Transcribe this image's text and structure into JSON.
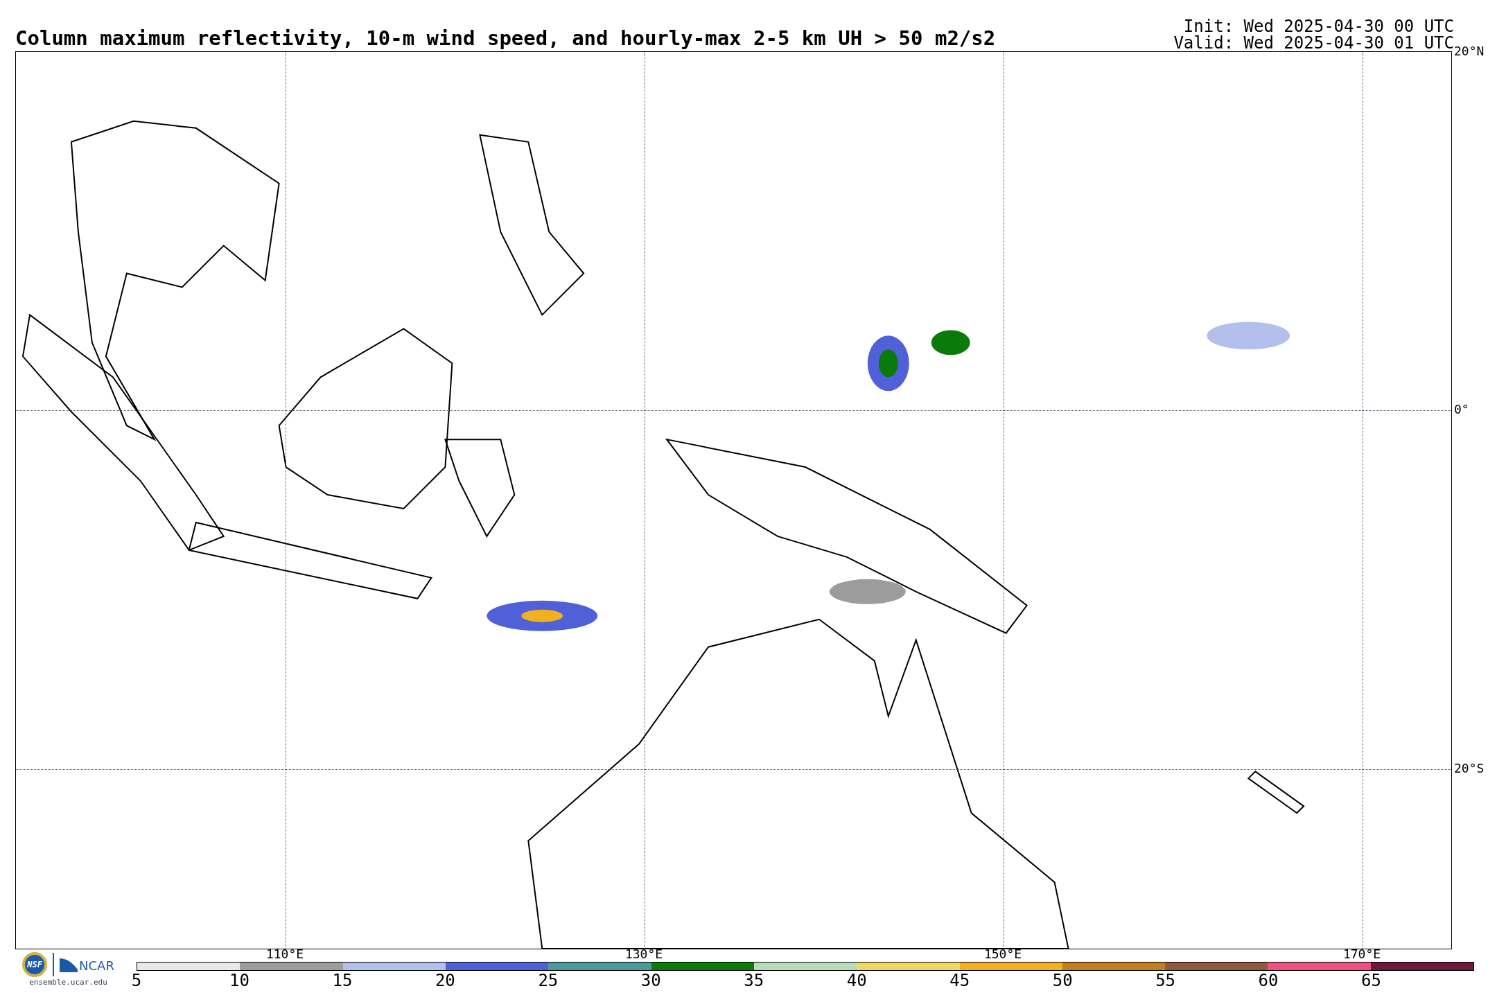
{
  "title": "Column maximum reflectivity, 10-m wind speed, and hourly-max 2-5 km UH > 50 m2/s2",
  "init": "Init: Wed 2025-04-30 00 UTC",
  "valid": "Valid: Wed 2025-04-30 01 UTC",
  "map": {
    "lat_labels": [
      "20°N",
      "0°",
      "20°S"
    ],
    "lon_labels": [
      "110°E",
      "130°E",
      "150°E",
      "170°E"
    ]
  },
  "logo": {
    "nsf": "NSF",
    "ncar": "NCAR",
    "url": "ensemble.ucar.edu"
  },
  "colorbar": {
    "segments": [
      {
        "color": "#e8e8e8"
      },
      {
        "color": "#9c9c9c"
      },
      {
        "color": "#b4c0ec"
      },
      {
        "color": "#5060d8"
      },
      {
        "color": "#4a9a9a"
      },
      {
        "color": "#0a7a0a"
      },
      {
        "color": "#b8dcb8"
      },
      {
        "color": "#f0d860"
      },
      {
        "color": "#f0b020"
      },
      {
        "color": "#c08020"
      },
      {
        "color": "#8c5c3c"
      },
      {
        "color": "#f05080"
      },
      {
        "color": "#6a1a3a"
      }
    ],
    "labels": [
      "5",
      "10",
      "15",
      "20",
      "25",
      "30",
      "35",
      "40",
      "45",
      "50",
      "55",
      "60",
      "65"
    ]
  }
}
